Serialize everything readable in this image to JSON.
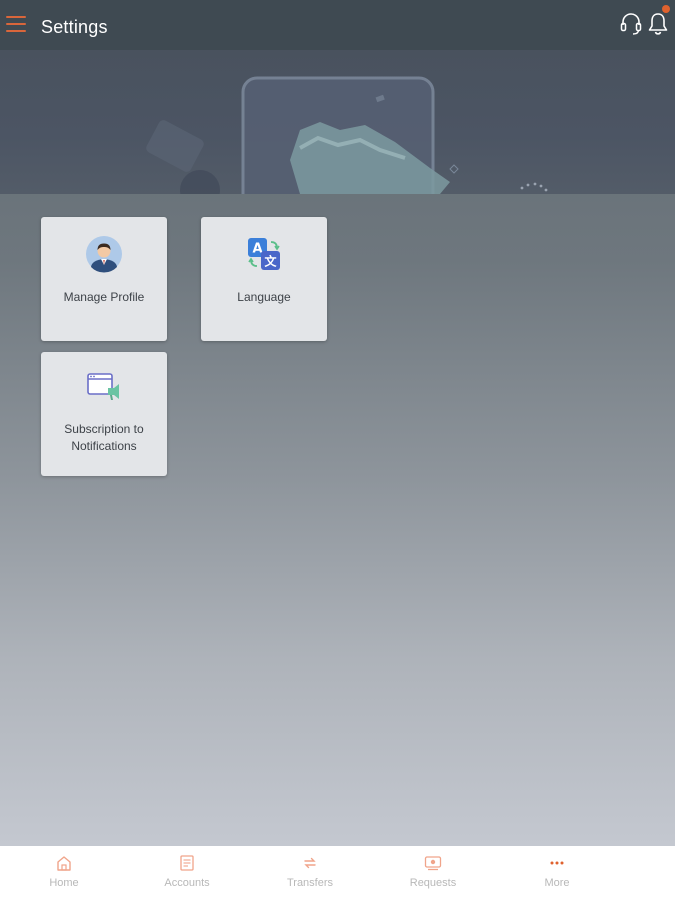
{
  "header": {
    "title": "Settings",
    "menu_icon": "hamburger-menu-icon",
    "support_icon": "headset-icon",
    "notifications_icon": "bell-icon",
    "has_unread_notifications": true
  },
  "tiles": [
    {
      "label": "Manage Profile",
      "icon": "profile-avatar-icon"
    },
    {
      "label": "Language",
      "icon": "translate-icon"
    },
    {
      "label": "Subscription to Notifications",
      "icon": "notification-subscription-icon"
    }
  ],
  "bottom_nav": [
    {
      "label": "Home",
      "icon": "home-icon"
    },
    {
      "label": "Accounts",
      "icon": "accounts-icon"
    },
    {
      "label": "Transfers",
      "icon": "transfers-icon"
    },
    {
      "label": "Requests",
      "icon": "requests-icon"
    },
    {
      "label": "More",
      "icon": "more-dots-icon"
    }
  ],
  "colors": {
    "accent": "#e0622e",
    "header_bg": "#3f4a52",
    "tile_bg": "#e3e5e8",
    "nav_label": "#b8b8b8"
  }
}
